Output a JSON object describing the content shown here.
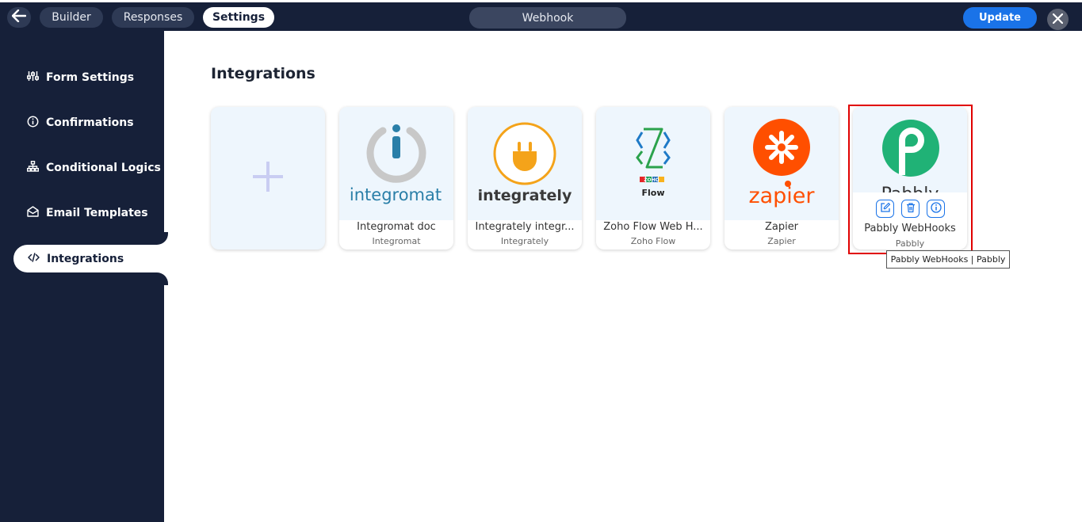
{
  "topbar": {
    "tabs": [
      {
        "label": "Builder",
        "active": false
      },
      {
        "label": "Responses",
        "active": false
      },
      {
        "label": "Settings",
        "active": true
      }
    ],
    "center_title": "Webhook",
    "update_label": "Update"
  },
  "sidebar": {
    "items": [
      {
        "label": "Form Settings",
        "icon": "sliders-icon"
      },
      {
        "label": "Confirmations",
        "icon": "info-circle-icon"
      },
      {
        "label": "Conditional Logics",
        "icon": "sitemap-icon"
      },
      {
        "label": "Email Templates",
        "icon": "envelope-open-icon"
      },
      {
        "label": "Integrations",
        "icon": "code-icon",
        "active": true
      }
    ]
  },
  "main": {
    "title": "Integrations",
    "cards": [
      {
        "title": "Integromat doc",
        "subtitle": "Integromat",
        "logo_text": "integromat"
      },
      {
        "title": "Integrately integr...",
        "subtitle": "Integrately",
        "logo_text": "integrately"
      },
      {
        "title": "Zoho Flow Web H...",
        "subtitle": "Zoho Flow",
        "logo_text": "Flow",
        "logo_zoho": "ZOHO"
      },
      {
        "title": "Zapier",
        "subtitle": "Zapier",
        "logo_text": "zapier"
      },
      {
        "title": "Pabbly WebHooks",
        "subtitle": "Pabbly",
        "logo_text": "Pabbly"
      }
    ],
    "tooltip": "Pabbly WebHooks | Pabbly"
  },
  "colors": {
    "navy": "#162039",
    "accent_blue": "#1a73e8",
    "highlight_red": "#e00000",
    "zapier_orange": "#ff4f00",
    "pabbly_green": "#20b276"
  }
}
